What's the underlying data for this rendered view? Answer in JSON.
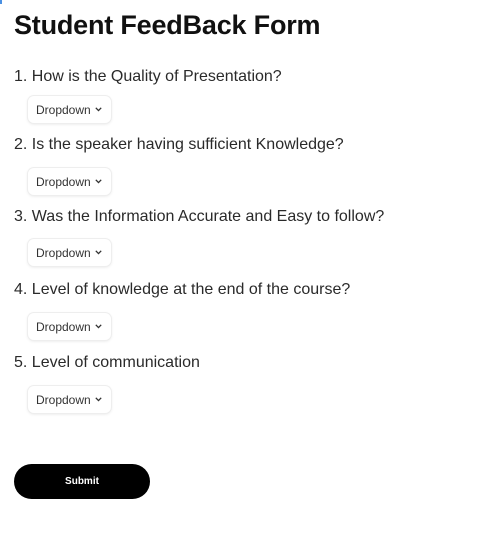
{
  "form": {
    "title": "Student FeedBack Form",
    "questions": [
      {
        "label": "1. How is the Quality of Presentation?",
        "dropdown": "Dropdown"
      },
      {
        "label": "2. Is the speaker having sufficient Knowledge?",
        "dropdown": "Dropdown"
      },
      {
        "label": "3. Was the Information Accurate and Easy to follow?",
        "dropdown": "Dropdown"
      },
      {
        "label": "4. Level of knowledge at the end of the course?",
        "dropdown": "Dropdown"
      },
      {
        "label": "5. Level of communication",
        "dropdown": "Dropdown"
      }
    ],
    "submit_label": "Submit"
  },
  "icons": {
    "dropdown_indicator": "chevron-down-icon"
  },
  "colors": {
    "text": "#1f1f1f",
    "submit_background": "#000000",
    "submit_text": "#ffffff",
    "corner_accent": "#4a90e2"
  }
}
